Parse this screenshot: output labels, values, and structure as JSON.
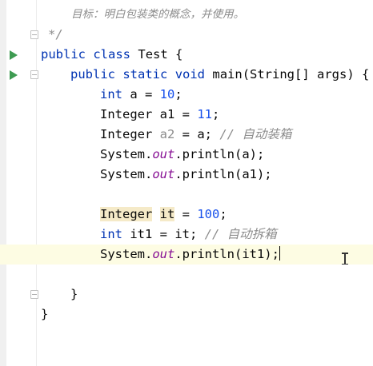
{
  "editor": {
    "lines": [
      {
        "text": "目标：明白包装类的概念，并使用。"
      },
      {
        "text": "*/"
      },
      {
        "kw1": "public",
        "kw2": "class",
        "name": "Test",
        "brace": "{"
      },
      {
        "kw1": "public",
        "kw2": "static",
        "kw3": "void",
        "name": "main",
        "params": "(String[] args)",
        "brace": "{"
      },
      {
        "type": "int",
        "rest": "a = ",
        "num": "10",
        "end": ";"
      },
      {
        "type": "Integer",
        "rest": "a1 = ",
        "num": "11",
        "end": ";"
      },
      {
        "type": "Integer",
        "var": "a2",
        "rest": " = a; ",
        "comment": "// 自动装箱"
      },
      {
        "cls": "System.",
        "field": "out",
        "call": ".println(a);"
      },
      {
        "cls": "System.",
        "field": "out",
        "call": ".println(a1);"
      },
      {
        "type": "Integer",
        "var": "it",
        "rest": " = ",
        "num": "100",
        "end": ";"
      },
      {
        "type": "int",
        "rest": "it1 = it; ",
        "comment": "// 自动拆箱"
      },
      {
        "cls": "System.",
        "field": "out",
        "call": ".println(it1);"
      },
      {
        "brace": "}"
      },
      {
        "brace": "}"
      }
    ],
    "icons": {
      "run": "run-icon",
      "fold": "fold-icon",
      "cursor": "text-cursor-icon"
    },
    "colors": {
      "keyword": "#0033b3",
      "number": "#1750eb",
      "comment": "#8c8c8c",
      "static_field": "#871094",
      "current_line": "#fdfce3",
      "usage_highlight": "#f5eac8",
      "run_icon": "#3e9b52"
    }
  }
}
